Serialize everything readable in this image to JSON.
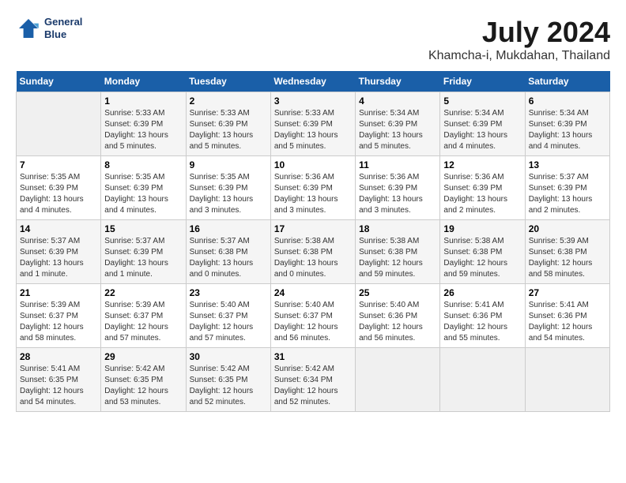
{
  "header": {
    "logo_line1": "General",
    "logo_line2": "Blue",
    "title": "July 2024",
    "subtitle": "Khamcha-i, Mukdahan, Thailand"
  },
  "columns": [
    "Sunday",
    "Monday",
    "Tuesday",
    "Wednesday",
    "Thursday",
    "Friday",
    "Saturday"
  ],
  "weeks": [
    [
      {
        "day": "",
        "sunrise": "",
        "sunset": "",
        "daylight": "",
        "empty": true
      },
      {
        "day": "1",
        "sunrise": "5:33 AM",
        "sunset": "6:39 PM",
        "daylight": "13 hours and 5 minutes."
      },
      {
        "day": "2",
        "sunrise": "5:33 AM",
        "sunset": "6:39 PM",
        "daylight": "13 hours and 5 minutes."
      },
      {
        "day": "3",
        "sunrise": "5:33 AM",
        "sunset": "6:39 PM",
        "daylight": "13 hours and 5 minutes."
      },
      {
        "day": "4",
        "sunrise": "5:34 AM",
        "sunset": "6:39 PM",
        "daylight": "13 hours and 5 minutes."
      },
      {
        "day": "5",
        "sunrise": "5:34 AM",
        "sunset": "6:39 PM",
        "daylight": "13 hours and 4 minutes."
      },
      {
        "day": "6",
        "sunrise": "5:34 AM",
        "sunset": "6:39 PM",
        "daylight": "13 hours and 4 minutes."
      }
    ],
    [
      {
        "day": "7",
        "sunrise": "5:35 AM",
        "sunset": "6:39 PM",
        "daylight": "13 hours and 4 minutes."
      },
      {
        "day": "8",
        "sunrise": "5:35 AM",
        "sunset": "6:39 PM",
        "daylight": "13 hours and 4 minutes."
      },
      {
        "day": "9",
        "sunrise": "5:35 AM",
        "sunset": "6:39 PM",
        "daylight": "13 hours and 3 minutes."
      },
      {
        "day": "10",
        "sunrise": "5:36 AM",
        "sunset": "6:39 PM",
        "daylight": "13 hours and 3 minutes."
      },
      {
        "day": "11",
        "sunrise": "5:36 AM",
        "sunset": "6:39 PM",
        "daylight": "13 hours and 3 minutes."
      },
      {
        "day": "12",
        "sunrise": "5:36 AM",
        "sunset": "6:39 PM",
        "daylight": "13 hours and 2 minutes."
      },
      {
        "day": "13",
        "sunrise": "5:37 AM",
        "sunset": "6:39 PM",
        "daylight": "13 hours and 2 minutes."
      }
    ],
    [
      {
        "day": "14",
        "sunrise": "5:37 AM",
        "sunset": "6:39 PM",
        "daylight": "13 hours and 1 minute."
      },
      {
        "day": "15",
        "sunrise": "5:37 AM",
        "sunset": "6:39 PM",
        "daylight": "13 hours and 1 minute."
      },
      {
        "day": "16",
        "sunrise": "5:37 AM",
        "sunset": "6:38 PM",
        "daylight": "13 hours and 0 minutes."
      },
      {
        "day": "17",
        "sunrise": "5:38 AM",
        "sunset": "6:38 PM",
        "daylight": "13 hours and 0 minutes."
      },
      {
        "day": "18",
        "sunrise": "5:38 AM",
        "sunset": "6:38 PM",
        "daylight": "12 hours and 59 minutes."
      },
      {
        "day": "19",
        "sunrise": "5:38 AM",
        "sunset": "6:38 PM",
        "daylight": "12 hours and 59 minutes."
      },
      {
        "day": "20",
        "sunrise": "5:39 AM",
        "sunset": "6:38 PM",
        "daylight": "12 hours and 58 minutes."
      }
    ],
    [
      {
        "day": "21",
        "sunrise": "5:39 AM",
        "sunset": "6:37 PM",
        "daylight": "12 hours and 58 minutes."
      },
      {
        "day": "22",
        "sunrise": "5:39 AM",
        "sunset": "6:37 PM",
        "daylight": "12 hours and 57 minutes."
      },
      {
        "day": "23",
        "sunrise": "5:40 AM",
        "sunset": "6:37 PM",
        "daylight": "12 hours and 57 minutes."
      },
      {
        "day": "24",
        "sunrise": "5:40 AM",
        "sunset": "6:37 PM",
        "daylight": "12 hours and 56 minutes."
      },
      {
        "day": "25",
        "sunrise": "5:40 AM",
        "sunset": "6:36 PM",
        "daylight": "12 hours and 56 minutes."
      },
      {
        "day": "26",
        "sunrise": "5:41 AM",
        "sunset": "6:36 PM",
        "daylight": "12 hours and 55 minutes."
      },
      {
        "day": "27",
        "sunrise": "5:41 AM",
        "sunset": "6:36 PM",
        "daylight": "12 hours and 54 minutes."
      }
    ],
    [
      {
        "day": "28",
        "sunrise": "5:41 AM",
        "sunset": "6:35 PM",
        "daylight": "12 hours and 54 minutes."
      },
      {
        "day": "29",
        "sunrise": "5:42 AM",
        "sunset": "6:35 PM",
        "daylight": "12 hours and 53 minutes."
      },
      {
        "day": "30",
        "sunrise": "5:42 AM",
        "sunset": "6:35 PM",
        "daylight": "12 hours and 52 minutes."
      },
      {
        "day": "31",
        "sunrise": "5:42 AM",
        "sunset": "6:34 PM",
        "daylight": "12 hours and 52 minutes."
      },
      {
        "day": "",
        "sunrise": "",
        "sunset": "",
        "daylight": "",
        "empty": true
      },
      {
        "day": "",
        "sunrise": "",
        "sunset": "",
        "daylight": "",
        "empty": true
      },
      {
        "day": "",
        "sunrise": "",
        "sunset": "",
        "daylight": "",
        "empty": true
      }
    ]
  ]
}
